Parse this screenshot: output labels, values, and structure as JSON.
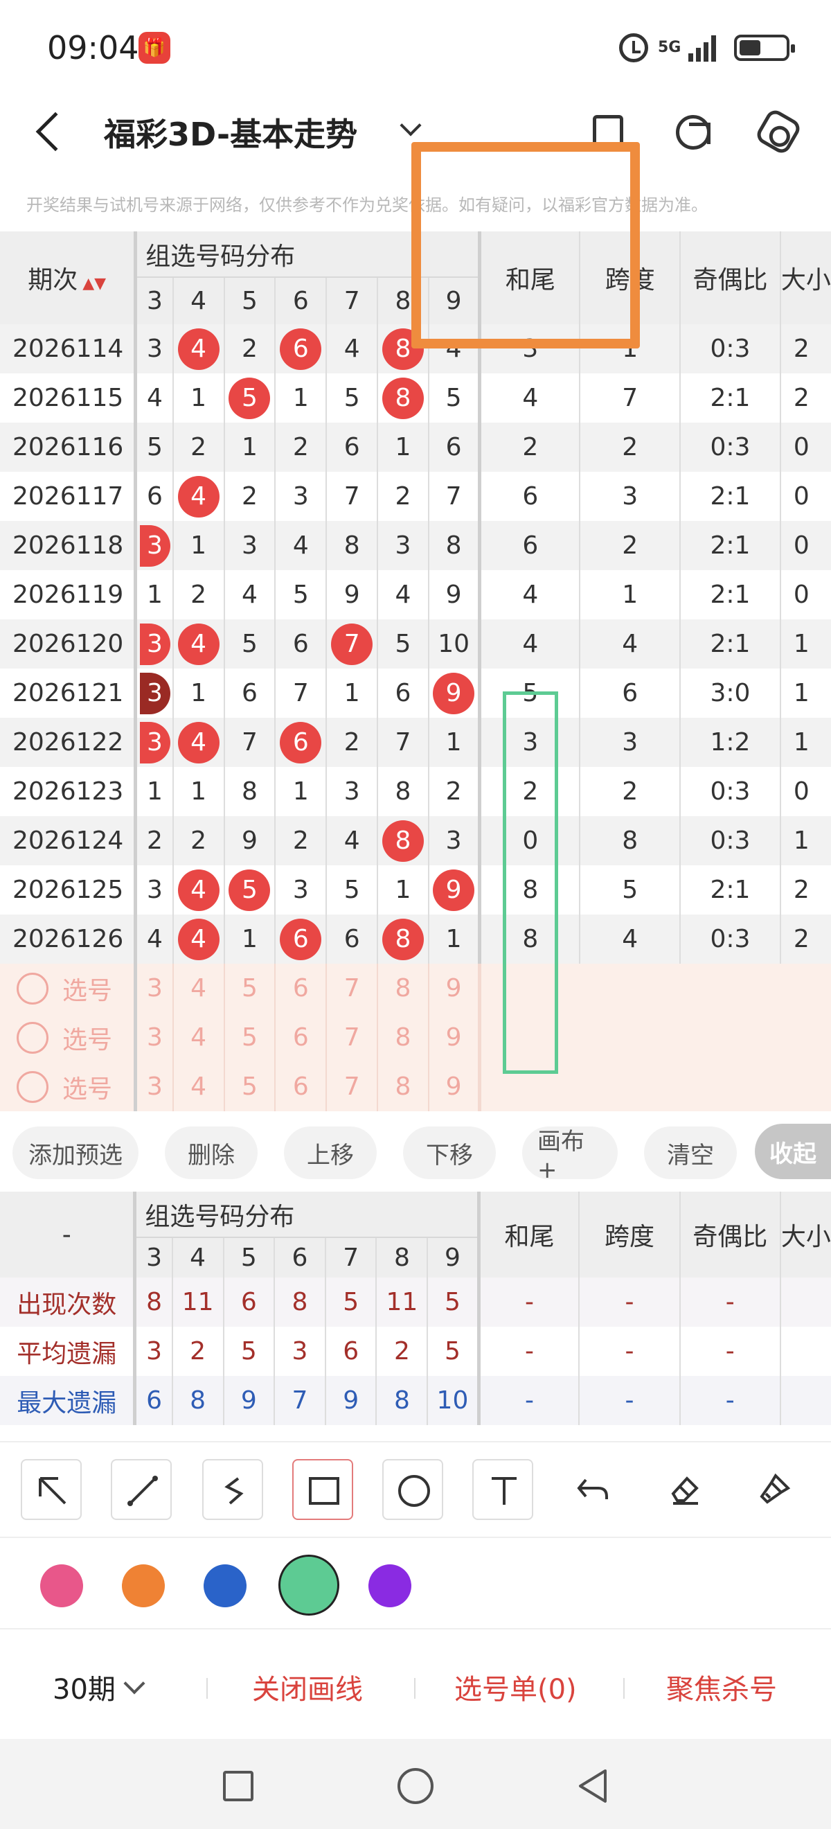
{
  "status_bar": {
    "time": "09:04",
    "app_icon": "购物节",
    "network": "5G",
    "icons": [
      "alarm-icon",
      "signal-icon",
      "battery-icon"
    ]
  },
  "header": {
    "title": "福彩3D-基本走势",
    "icons": [
      "back-icon",
      "chevron-down-icon",
      "copy-icon",
      "share-icon",
      "settings-icon"
    ]
  },
  "disclaimer": "开奖结果与试机号来源于网络，仅供参考不作为兑奖依据。如有疑问，以福彩官方数据为准。",
  "table": {
    "issue_header": "期次",
    "group_header": "组选号码分布",
    "digits": [
      "3",
      "4",
      "5",
      "6",
      "7",
      "8",
      "9"
    ],
    "extra_headers": [
      "和尾",
      "跨度",
      "奇偶比",
      "大小"
    ],
    "rows": [
      {
        "issue": "2026114",
        "cells": [
          "3",
          "4",
          "2",
          "6",
          "4",
          "8",
          "4"
        ],
        "hits": [
          false,
          true,
          false,
          true,
          false,
          true,
          false
        ],
        "sum": "3",
        "span": "1",
        "odd": "0:3",
        "big": "2"
      },
      {
        "issue": "2026115",
        "cells": [
          "4",
          "1",
          "5",
          "1",
          "5",
          "8",
          "5"
        ],
        "hits": [
          false,
          false,
          true,
          false,
          false,
          true,
          false
        ],
        "sum": "4",
        "span": "7",
        "odd": "2:1",
        "big": "2"
      },
      {
        "issue": "2026116",
        "cells": [
          "5",
          "2",
          "1",
          "2",
          "6",
          "1",
          "6"
        ],
        "hits": [
          false,
          false,
          false,
          false,
          false,
          false,
          false
        ],
        "sum": "2",
        "span": "2",
        "odd": "0:3",
        "big": "0"
      },
      {
        "issue": "2026117",
        "cells": [
          "6",
          "4",
          "2",
          "3",
          "7",
          "2",
          "7"
        ],
        "hits": [
          false,
          true,
          false,
          false,
          false,
          false,
          false
        ],
        "sum": "6",
        "span": "3",
        "odd": "2:1",
        "big": "0"
      },
      {
        "issue": "2026118",
        "cells": [
          "3",
          "1",
          "3",
          "4",
          "8",
          "3",
          "8"
        ],
        "hits": [
          true,
          false,
          false,
          false,
          false,
          false,
          false
        ],
        "sum": "6",
        "span": "2",
        "odd": "2:1",
        "big": "0"
      },
      {
        "issue": "2026119",
        "cells": [
          "1",
          "2",
          "4",
          "5",
          "9",
          "4",
          "9"
        ],
        "hits": [
          false,
          false,
          false,
          false,
          false,
          false,
          false
        ],
        "sum": "4",
        "span": "1",
        "odd": "2:1",
        "big": "0"
      },
      {
        "issue": "2026120",
        "cells": [
          "3",
          "4",
          "5",
          "6",
          "7",
          "5",
          "10"
        ],
        "hits": [
          true,
          true,
          false,
          false,
          true,
          false,
          false
        ],
        "sum": "4",
        "span": "4",
        "odd": "2:1",
        "big": "1"
      },
      {
        "issue": "2026121",
        "cells": [
          "3",
          "1",
          "6",
          "7",
          "1",
          "6",
          "9"
        ],
        "hits": [
          true,
          false,
          false,
          false,
          false,
          false,
          true
        ],
        "sum": "5",
        "span": "6",
        "odd": "3:0",
        "big": "1"
      },
      {
        "issue": "2026122",
        "cells": [
          "3",
          "4",
          "7",
          "6",
          "2",
          "7",
          "1"
        ],
        "hits": [
          true,
          true,
          false,
          true,
          false,
          false,
          false
        ],
        "sum": "3",
        "span": "3",
        "odd": "1:2",
        "big": "1"
      },
      {
        "issue": "2026123",
        "cells": [
          "1",
          "1",
          "8",
          "1",
          "3",
          "8",
          "2"
        ],
        "hits": [
          false,
          false,
          false,
          false,
          false,
          false,
          false
        ],
        "sum": "2",
        "span": "2",
        "odd": "0:3",
        "big": "0"
      },
      {
        "issue": "2026124",
        "cells": [
          "2",
          "2",
          "9",
          "2",
          "4",
          "8",
          "3"
        ],
        "hits": [
          false,
          false,
          false,
          false,
          false,
          true,
          false
        ],
        "sum": "0",
        "span": "8",
        "odd": "0:3",
        "big": "1"
      },
      {
        "issue": "2026125",
        "cells": [
          "3",
          "4",
          "5",
          "3",
          "5",
          "1",
          "9"
        ],
        "hits": [
          false,
          true,
          true,
          false,
          false,
          false,
          true
        ],
        "sum": "8",
        "span": "5",
        "odd": "2:1",
        "big": "2"
      },
      {
        "issue": "2026126",
        "cells": [
          "4",
          "4",
          "1",
          "6",
          "6",
          "8",
          "1"
        ],
        "hits": [
          false,
          true,
          false,
          true,
          false,
          true,
          false
        ],
        "sum": "8",
        "span": "4",
        "odd": "0:3",
        "big": "2"
      }
    ],
    "pick_label": "选号",
    "pick_rows": 3
  },
  "actions": [
    "添加预选",
    "删除",
    "上移",
    "下移",
    "画布+",
    "清空"
  ],
  "collapse_label": "收起",
  "stats": {
    "corner": "-",
    "rows": [
      {
        "label": "出现次数",
        "values": [
          "8",
          "11",
          "6",
          "8",
          "5",
          "11",
          "5"
        ],
        "extras": [
          "-",
          "-",
          "-"
        ]
      },
      {
        "label": "平均遗漏",
        "values": [
          "3",
          "2",
          "5",
          "3",
          "6",
          "2",
          "5"
        ],
        "extras": [
          "-",
          "-",
          "-"
        ]
      },
      {
        "label": "最大遗漏",
        "values": [
          "6",
          "8",
          "9",
          "7",
          "9",
          "8",
          "10"
        ],
        "extras": [
          "-",
          "-",
          "-"
        ]
      }
    ]
  },
  "draw_tools": [
    "arrow-tool-icon",
    "line-tool-icon",
    "freehand-tool-icon",
    "rectangle-tool-icon",
    "circle-tool-icon",
    "text-tool-icon",
    "undo-icon",
    "eraser-icon",
    "clear-brush-icon"
  ],
  "colors": {
    "swatches": [
      "#e8578a",
      "#ef8234",
      "#2a63c9",
      "#5dcb93",
      "#8a2be2"
    ],
    "selected_swatch": "#5dcb93",
    "ball_red": "#e84745",
    "ball_dark": "#9a2a24",
    "link_red": "#d9433d"
  },
  "bottom_bar": {
    "period": "30期",
    "close_drawing": "关闭画线",
    "pick_list": "选号单(0)",
    "focus_kill": "聚焦杀号"
  },
  "nav_icons": [
    "recent-apps-icon",
    "home-icon",
    "back-nav-icon"
  ]
}
